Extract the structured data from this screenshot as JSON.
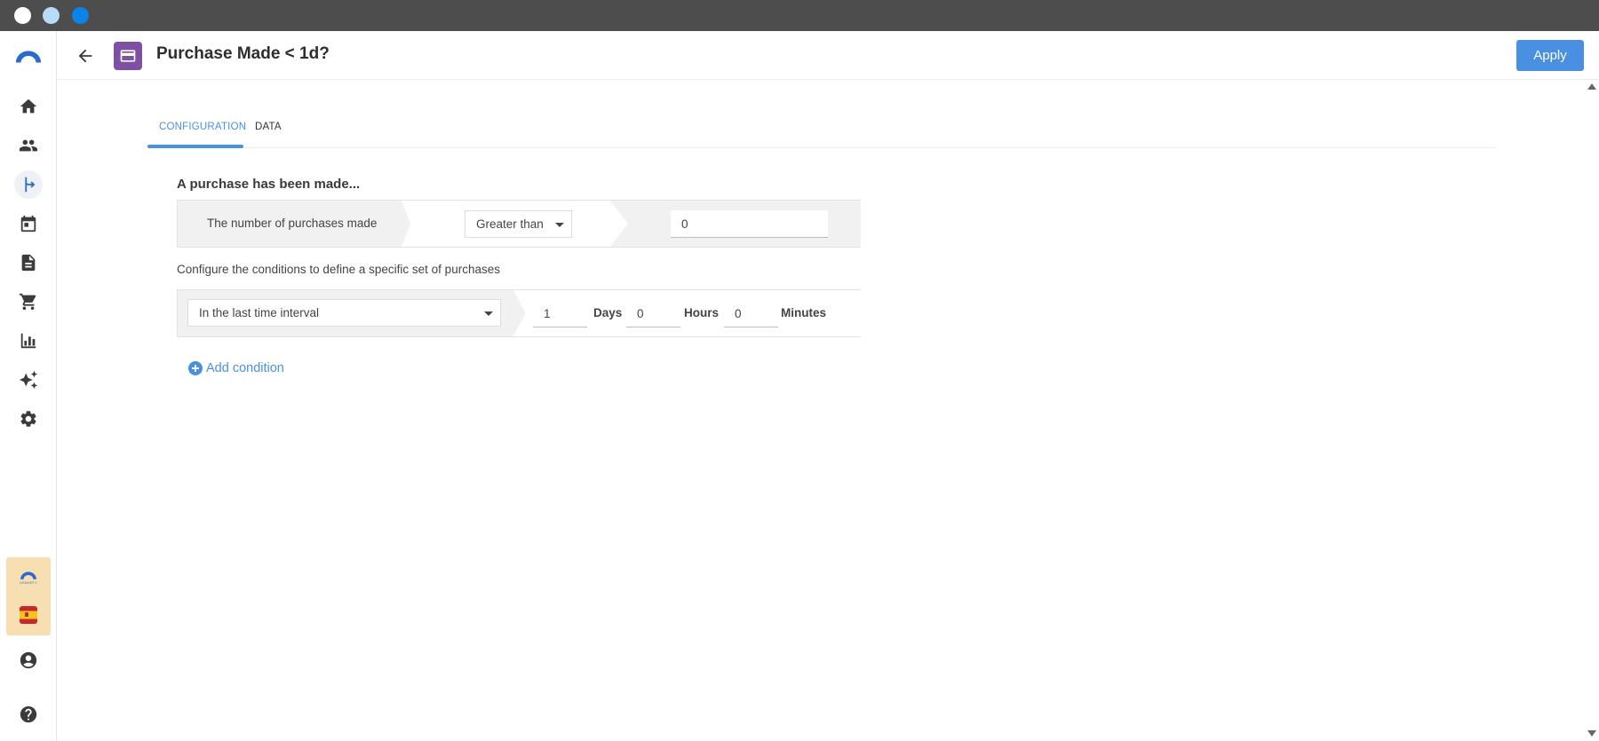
{
  "header": {
    "title": "Purchase Made < 1d?",
    "apply_label": "Apply"
  },
  "sidebar": {
    "items": [
      {
        "icon": "home-icon"
      },
      {
        "icon": "people-icon"
      },
      {
        "icon": "journey-icon",
        "active": true
      },
      {
        "icon": "calendar-icon"
      },
      {
        "icon": "document-icon"
      },
      {
        "icon": "cart-icon"
      },
      {
        "icon": "bar-chart-icon"
      },
      {
        "icon": "sparkle-icon"
      },
      {
        "icon": "gear-icon"
      }
    ],
    "workspace_logo_text": "DEMARTY"
  },
  "tabs": [
    {
      "label": "CONFIGURATION",
      "active": true
    },
    {
      "label": "DATA",
      "active": false
    }
  ],
  "main": {
    "section_title": "A purchase has been made...",
    "metric_label": "The number of purchases made",
    "comparator": "Greater than",
    "threshold_value": "0",
    "configure_text": "Configure the conditions to define a specific set of purchases",
    "time_condition": "In the last time interval",
    "days_value": "1",
    "days_label": "Days",
    "hours_value": "0",
    "hours_label": "Hours",
    "minutes_value": "0",
    "minutes_label": "Minutes",
    "add_condition_label": "Add condition"
  },
  "colors": {
    "accent": "#4a90e2",
    "node_icon": "#7e4fa3",
    "titlebar": "#4d4d4d"
  }
}
